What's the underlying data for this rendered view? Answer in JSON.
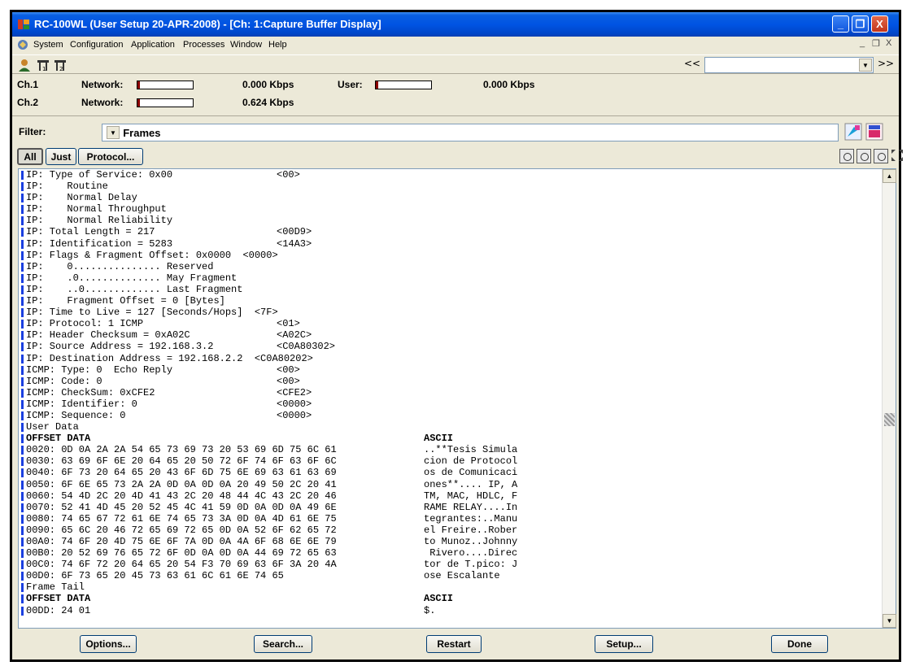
{
  "window": {
    "title": "RC-100WL (User Setup 20-APR-2008) - [Ch: 1:Capture Buffer Display]",
    "min_glyph": "_",
    "max_glyph": "❐",
    "close_glyph": "X"
  },
  "menu": {
    "items": [
      "System",
      "Configuration",
      "Application",
      "Processes",
      "Window",
      "Help"
    ],
    "mdi_controls": [
      "_",
      "❐",
      "X"
    ]
  },
  "toolbar": {
    "prev_label": "<<",
    "next_label": ">>",
    "combo_value": ""
  },
  "status": {
    "ch1": {
      "label": "Ch.1",
      "network_label": "Network:",
      "network_rate": "0.000 Kbps",
      "user_label": "User:",
      "user_rate": "0.000 Kbps"
    },
    "ch2": {
      "label": "Ch.2",
      "network_label": "Network:",
      "network_rate": "0.624 Kbps"
    }
  },
  "filter": {
    "label": "Filter:",
    "value": "All Frames"
  },
  "buttons": {
    "all": "All",
    "just": "Just",
    "protocol": "Protocol..."
  },
  "decode_lines": [
    {
      "mark": true,
      "bold": false,
      "a": "IP: Type of Service: 0x00",
      "b": "<00>"
    },
    {
      "mark": true,
      "bold": false,
      "a": "IP:    Routine",
      "b": ""
    },
    {
      "mark": true,
      "bold": false,
      "a": "IP:    Normal Delay",
      "b": ""
    },
    {
      "mark": true,
      "bold": false,
      "a": "IP:    Normal Throughput",
      "b": ""
    },
    {
      "mark": true,
      "bold": false,
      "a": "IP:    Normal Reliability",
      "b": ""
    },
    {
      "mark": true,
      "bold": false,
      "a": "IP: Total Length = 217",
      "b": "<00D9>"
    },
    {
      "mark": true,
      "bold": false,
      "a": "IP: Identification = 5283",
      "b": "<14A3>"
    },
    {
      "mark": true,
      "bold": false,
      "a": "IP: Flags & Fragment Offset: 0x0000  <0000>",
      "b": ""
    },
    {
      "mark": true,
      "bold": false,
      "a": "IP:    0............... Reserved",
      "b": ""
    },
    {
      "mark": true,
      "bold": false,
      "a": "IP:    .0.............. May Fragment",
      "b": ""
    },
    {
      "mark": true,
      "bold": false,
      "a": "IP:    ..0............. Last Fragment",
      "b": ""
    },
    {
      "mark": true,
      "bold": false,
      "a": "IP:    Fragment Offset = 0 [Bytes]",
      "b": ""
    },
    {
      "mark": true,
      "bold": false,
      "a": "IP: Time to Live = 127 [Seconds/Hops]  <7F>",
      "b": ""
    },
    {
      "mark": true,
      "bold": false,
      "a": "IP: Protocol: 1 ICMP",
      "b": "<01>"
    },
    {
      "mark": true,
      "bold": false,
      "a": "IP: Header Checksum = 0xA02C",
      "b": "<A02C>"
    },
    {
      "mark": true,
      "bold": false,
      "a": "IP: Source Address = 192.168.3.2",
      "b": "<C0A80302>"
    },
    {
      "mark": true,
      "bold": false,
      "a": "IP: Destination Address = 192.168.2.2  <C0A80202>",
      "b": ""
    },
    {
      "mark": true,
      "bold": false,
      "a": "ICMP: Type: 0  Echo Reply",
      "b": "<00>"
    },
    {
      "mark": true,
      "bold": false,
      "a": "ICMP: Code: 0",
      "b": "<00>"
    },
    {
      "mark": true,
      "bold": false,
      "a": "ICMP: CheckSum: 0xCFE2",
      "b": "<CFE2>"
    },
    {
      "mark": true,
      "bold": false,
      "a": "ICMP: Identifier: 0",
      "b": "<0000>"
    },
    {
      "mark": true,
      "bold": false,
      "a": "ICMP: Sequence: 0",
      "b": "<0000>"
    },
    {
      "mark": true,
      "bold": false,
      "a": "User Data",
      "b": ""
    },
    {
      "mark": true,
      "bold": true,
      "a": "OFFSET DATA",
      "b": "",
      "c": "ASCII"
    },
    {
      "mark": true,
      "bold": false,
      "a": "0020: 0D 0A 2A 2A 54 65 73 69 73 20 53 69 6D 75 6C 61",
      "c": "..**Tesis Simula"
    },
    {
      "mark": true,
      "bold": false,
      "a": "0030: 63 69 6F 6E 20 64 65 20 50 72 6F 74 6F 63 6F 6C",
      "c": "cion de Protocol"
    },
    {
      "mark": true,
      "bold": false,
      "a": "0040: 6F 73 20 64 65 20 43 6F 6D 75 6E 69 63 61 63 69",
      "c": "os de Comunicaci"
    },
    {
      "mark": true,
      "bold": false,
      "a": "0050: 6F 6E 65 73 2A 2A 0D 0A 0D 0A 20 49 50 2C 20 41",
      "c": "ones**.... IP, A"
    },
    {
      "mark": true,
      "bold": false,
      "a": "0060: 54 4D 2C 20 4D 41 43 2C 20 48 44 4C 43 2C 20 46",
      "c": "TM, MAC, HDLC, F"
    },
    {
      "mark": true,
      "bold": false,
      "a": "0070: 52 41 4D 45 20 52 45 4C 41 59 0D 0A 0D 0A 49 6E",
      "c": "RAME RELAY....In"
    },
    {
      "mark": true,
      "bold": false,
      "a": "0080: 74 65 67 72 61 6E 74 65 73 3A 0D 0A 4D 61 6E 75",
      "c": "tegrantes:..Manu"
    },
    {
      "mark": true,
      "bold": false,
      "a": "0090: 65 6C 20 46 72 65 69 72 65 0D 0A 52 6F 62 65 72",
      "c": "el Freire..Rober"
    },
    {
      "mark": true,
      "bold": false,
      "a": "00A0: 74 6F 20 4D 75 6E 6F 7A 0D 0A 4A 6F 68 6E 6E 79",
      "c": "to Munoz..Johnny"
    },
    {
      "mark": true,
      "bold": false,
      "a": "00B0: 20 52 69 76 65 72 6F 0D 0A 0D 0A 44 69 72 65 63",
      "c": " Rivero....Direc"
    },
    {
      "mark": true,
      "bold": false,
      "a": "00C0: 74 6F 72 20 64 65 20 54 F3 70 69 63 6F 3A 20 4A",
      "c": "tor de T.pico: J"
    },
    {
      "mark": true,
      "bold": false,
      "a": "00D0: 6F 73 65 20 45 73 63 61 6C 61 6E 74 65",
      "c": "ose Escalante"
    },
    {
      "mark": true,
      "bold": false,
      "a": "Frame Tail",
      "b": ""
    },
    {
      "mark": true,
      "bold": true,
      "a": "OFFSET DATA",
      "c": "ASCII"
    },
    {
      "mark": true,
      "bold": false,
      "a": "00DD: 24 01",
      "c": "$."
    }
  ],
  "bottom_buttons": {
    "options": "Options...",
    "search": "Search...",
    "restart": "Restart",
    "setup": "Setup...",
    "done": "Done"
  }
}
